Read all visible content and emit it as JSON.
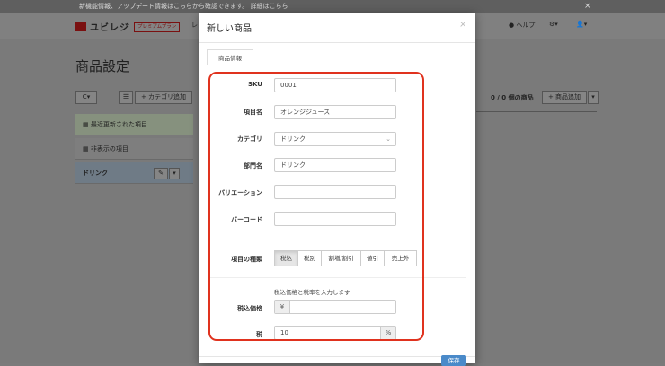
{
  "notice": {
    "text": "新機能情報、アップデート情報はこちらから確認できます。 詳細はこちら",
    "close": "×"
  },
  "header": {
    "logo_text": "ユビレジ",
    "plan_badge": "プレミアムプラン",
    "cut_label": "レ",
    "help_label": "ヘルプ",
    "help_icon": "question-circle-icon",
    "settings_icon": "gear-icon",
    "user_icon": "user-icon"
  },
  "page": {
    "title": "商品設定",
    "refresh_label": "C",
    "add_category_label": "カテゴリ追加",
    "count_label": "0 / 0 個の商品",
    "add_item_label": "商品追加",
    "sidebar": [
      {
        "label": "最近更新された項目"
      },
      {
        "label": "非表示の項目"
      },
      {
        "label": "ドリンク"
      }
    ]
  },
  "modal": {
    "title": "新しい商品",
    "close": "×",
    "tab": "商品情報",
    "fields": {
      "sku": {
        "label": "SKU",
        "value": "0001"
      },
      "name": {
        "label": "項目名",
        "value": "オレンジジュース"
      },
      "category": {
        "label": "カテゴリ",
        "value": "ドリンク"
      },
      "department": {
        "label": "部門名",
        "value": "ドリンク"
      },
      "variation": {
        "label": "バリエーション",
        "value": ""
      },
      "barcode": {
        "label": "バーコード",
        "value": ""
      },
      "item_type": {
        "label": "項目の種類",
        "options": [
          "税込",
          "税別",
          "割増/割引",
          "値引",
          "売上外"
        ],
        "selected": "税込"
      }
    },
    "price_hint": "税込価格と税率を入力します",
    "price": {
      "label": "税込価格",
      "prefix": "¥",
      "value": ""
    },
    "tax": {
      "label": "税",
      "value": "10",
      "suffix": "%"
    },
    "save_label": "保存"
  },
  "colors": {
    "highlight": "#e0321e",
    "primary": "#4a8ac9",
    "brand": "#7a1010"
  }
}
